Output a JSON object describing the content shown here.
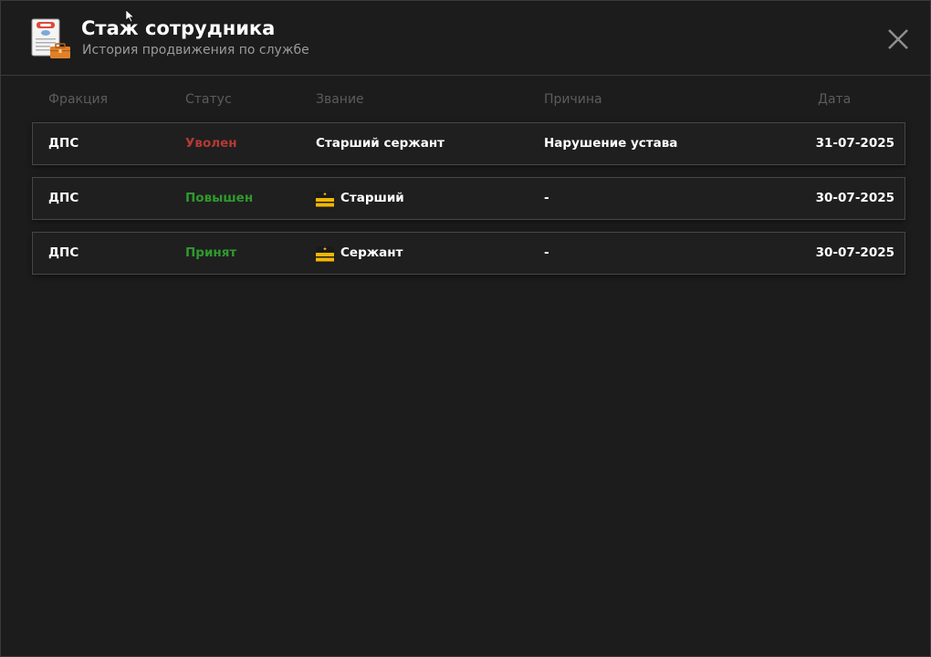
{
  "header": {
    "title": "Стаж сотрудника",
    "subtitle": "История продвижения по службе",
    "icon": "document-briefcase-icon",
    "close_icon": "close-icon"
  },
  "columns": {
    "faction": "Фракция",
    "status": "Статус",
    "rank": "Звание",
    "reason": "Причина",
    "date": "Дата"
  },
  "rows": [
    {
      "faction": "ДПС",
      "status": "Уволен",
      "status_color": "#b43a35",
      "rank": "Старший сержант",
      "rank_icon": "",
      "reason": "Нарушение устава",
      "date": "31-07-2025"
    },
    {
      "faction": "ДПС",
      "status": "Повышен",
      "status_color": "#2f9a2c",
      "rank": "Старший",
      "rank_icon": "rank-insignia-icon",
      "reason": "-",
      "date": "30-07-2025"
    },
    {
      "faction": "ДПС",
      "status": "Принят",
      "status_color": "#2f9a2c",
      "rank": "Сержант",
      "rank_icon": "rank-insignia-icon",
      "reason": "-",
      "date": "30-07-2025"
    }
  ],
  "colors": {
    "background": "#1c1c1c",
    "row_border": "#474747",
    "header_text": "#5c5c5c",
    "fired": "#b43a35",
    "promoted": "#2f9a2c",
    "insignia": "#f2b705"
  }
}
